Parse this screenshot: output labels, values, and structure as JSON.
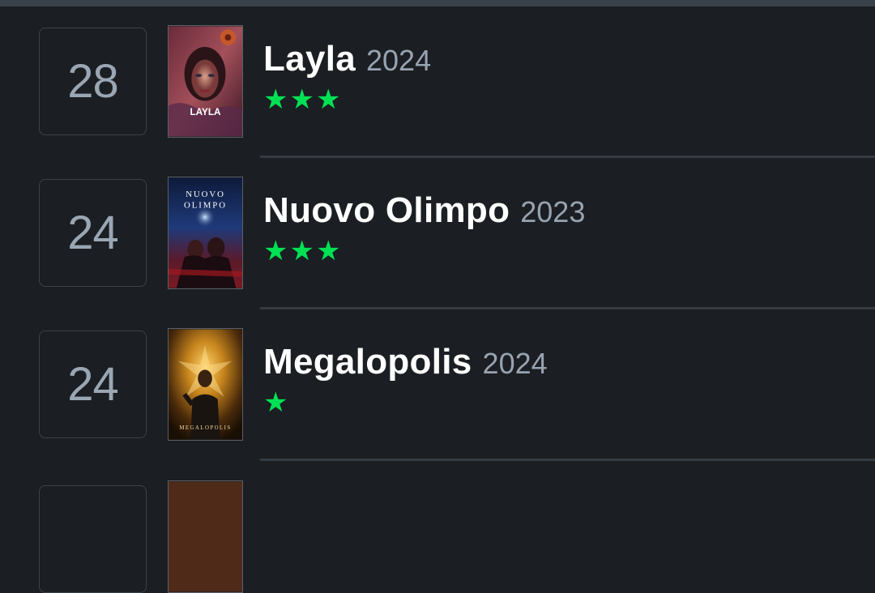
{
  "diary": {
    "entries": [
      {
        "day": "28",
        "title": "Layla",
        "year": "2024",
        "rating_stars": 3,
        "rating_display": "★★★",
        "poster_caption": "LAYLA",
        "star_color": "#00e054"
      },
      {
        "day": "24",
        "title": "Nuovo Olimpo",
        "year": "2023",
        "rating_stars": 3,
        "rating_display": "★★★",
        "poster_caption_line1": "NUOVO",
        "poster_caption_line2": "OLIMPO",
        "star_color": "#00e054"
      },
      {
        "day": "24",
        "title": "Megalopolis",
        "year": "2024",
        "rating_stars": 1,
        "rating_display": "★",
        "poster_caption": "MEGALOPOLIS",
        "star_color": "#00e054"
      }
    ]
  },
  "colors": {
    "background": "#1b1e22",
    "title": "#ffffff",
    "year": "#97a3b0",
    "day_number": "#9aa6b3",
    "star": "#00e054",
    "divider": "#353b42"
  }
}
